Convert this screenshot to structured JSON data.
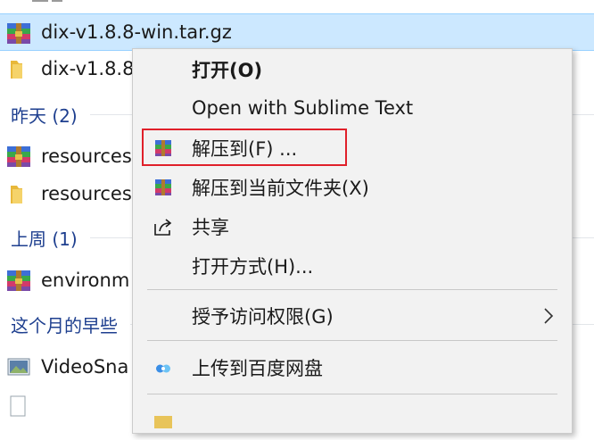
{
  "explorer": {
    "files": [
      {
        "name": "dix-v1.8.8-win.tar.gz",
        "icon": "archive-icon",
        "selected": true
      },
      {
        "name": "dix-v1.8.8",
        "icon": "folder-icon",
        "selected": false
      }
    ],
    "groups": [
      {
        "title": "昨天 (2)",
        "items": [
          {
            "name": "resources.",
            "icon": "archive-icon"
          },
          {
            "name": "resources",
            "icon": "folder-icon"
          }
        ]
      },
      {
        "title": "上周 (1)",
        "items": [
          {
            "name": "environm",
            "icon": "archive-icon"
          }
        ]
      },
      {
        "title": "这个月的早些",
        "items": [
          {
            "name": "VideoSna",
            "icon": "video-file-icon"
          }
        ]
      }
    ]
  },
  "context_menu": {
    "items": [
      {
        "label": "打开(O)",
        "bold": true,
        "icon": null
      },
      {
        "label": "Open with Sublime Text",
        "icon": null
      },
      {
        "label": "解压到(F) ...",
        "icon": "winrar-icon",
        "highlighted": true
      },
      {
        "label": "解压到当前文件夹(X)",
        "icon": "winrar-icon"
      },
      {
        "label": "共享",
        "icon": "share-icon"
      },
      {
        "label": "打开方式(H)...",
        "icon": null
      },
      {
        "label": "授予访问权限(G)",
        "icon": null,
        "submenu": true
      },
      {
        "label": "上传到百度网盘",
        "icon": "baidu-netdisk-icon"
      }
    ]
  },
  "colors": {
    "selection": "#cce8ff",
    "group_title": "#1e3f8f",
    "menu_bg": "#f2f2f2",
    "highlight_border": "#e0202a"
  }
}
